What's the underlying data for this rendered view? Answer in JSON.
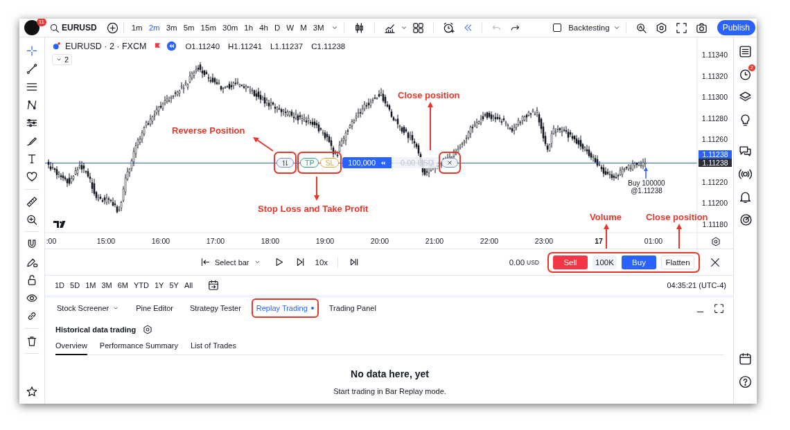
{
  "top_bar": {
    "avatar_badge": "11",
    "symbol": "EURUSD",
    "intervals": [
      {
        "label": "1m",
        "selected": false
      },
      {
        "label": "2m",
        "selected": true
      },
      {
        "label": "3m",
        "selected": false
      },
      {
        "label": "5m",
        "selected": false
      },
      {
        "label": "15m",
        "selected": false
      },
      {
        "label": "30m",
        "selected": false
      },
      {
        "label": "1h",
        "selected": false
      },
      {
        "label": "4h",
        "selected": false
      },
      {
        "label": "D",
        "selected": false
      },
      {
        "label": "W",
        "selected": false
      },
      {
        "label": "M",
        "selected": false
      },
      {
        "label": "3M",
        "selected": false
      }
    ],
    "history_buttons": [
      {
        "disabled": true
      },
      {
        "disabled": false
      }
    ],
    "backtesting": {
      "label": "Backtesting",
      "checked": false
    },
    "publish": "Publish"
  },
  "left_toolbar": {
    "tools": [
      {
        "selected": true
      },
      {
        "selected": false
      },
      {
        "selected": false
      },
      {
        "selected": false
      },
      {
        "selected": false
      },
      {
        "selected": false
      },
      {
        "selected": false
      },
      {
        "selected": false
      },
      {
        "selected": false
      },
      {
        "selected": false
      },
      {
        "selected": false
      },
      {
        "selected": false
      },
      {
        "selected": false
      },
      {
        "selected": false
      },
      {
        "selected": false
      },
      {
        "selected": false
      },
      {
        "selected": false
      }
    ]
  },
  "right_toolbar": {
    "alerts_badge": "2"
  },
  "chart": {
    "title": "EURUSD · 2 · FXCM",
    "ohlc": [
      "O1.11240",
      "H1.11241",
      "L1.11237",
      "C1.11238"
    ],
    "collapsed_count": "2",
    "price_axis": [
      "1.11340",
      "1.11320",
      "1.11300",
      "1.11280",
      "1.11260",
      "1.11220",
      "1.11200",
      "1.11180"
    ],
    "price_tags": [
      {
        "color": "#2962ff",
        "text": "1.11238"
      },
      {
        "color": "#2a2e39",
        "text": "1.11238"
      }
    ],
    "time_axis": [
      {
        "label": ":00",
        "bold": false
      },
      {
        "label": "15:00",
        "bold": false
      },
      {
        "label": "16:00",
        "bold": false
      },
      {
        "label": "17:00",
        "bold": false
      },
      {
        "label": "18:00",
        "bold": false
      },
      {
        "label": "19:00",
        "bold": false
      },
      {
        "label": "20:00",
        "bold": false
      },
      {
        "label": "21:00",
        "bold": false
      },
      {
        "label": "22:00",
        "bold": false
      },
      {
        "label": "23:00",
        "bold": false
      },
      {
        "label": "17",
        "bold": true
      },
      {
        "label": "01:00",
        "bold": false
      }
    ],
    "position": {
      "groups": [
        {
          "kind": "reverse",
          "highlighted": true
        },
        {
          "kind": "brackets",
          "highlighted": true,
          "items": [
            {
              "label": "TP",
              "color": "#26a17b"
            },
            {
              "label": "SL",
              "color": "#e5a43a"
            }
          ]
        },
        {
          "kind": "quantity",
          "highlighted": false,
          "text": "100,000"
        },
        {
          "kind": "pnl",
          "highlighted": false,
          "text": "0.00 USD"
        },
        {
          "kind": "close",
          "highlighted": true
        }
      ]
    },
    "trade_marker": [
      "Buy 100000",
      "@1.11238"
    ]
  },
  "annotations": [
    "Reverse Position",
    "Stop Loss and Take Profit",
    "Close position",
    "Volume",
    "Close position"
  ],
  "replay_bar": {
    "select_bar": "Select bar",
    "speed": "10x",
    "pnl": {
      "value": "0.00",
      "currency": "USD"
    },
    "order_panel": {
      "highlighted": true,
      "buttons": [
        {
          "kind": "sell",
          "label": "Sell"
        },
        {
          "kind": "quantity",
          "label": "100K"
        },
        {
          "kind": "buy",
          "label": "Buy"
        },
        {
          "kind": "flatten",
          "label": "Flatten"
        }
      ]
    }
  },
  "range_bar": {
    "ranges": [
      "1D",
      "5D",
      "1M",
      "3M",
      "6M",
      "YTD",
      "1Y",
      "5Y",
      "All"
    ],
    "clock": "04:35:21 (UTC-4)"
  },
  "bottom_panel": {
    "tabs": [
      {
        "label": "Stock Screener",
        "selected": false,
        "dropdown": true,
        "dot": false,
        "highlighted": false
      },
      {
        "label": "Pine Editor",
        "selected": false,
        "dropdown": false,
        "dot": false,
        "highlighted": false
      },
      {
        "label": "Strategy Tester",
        "selected": false,
        "dropdown": false,
        "dot": false,
        "highlighted": false
      },
      {
        "label": "Replay Trading",
        "selected": true,
        "dropdown": false,
        "dot": true,
        "highlighted": true
      },
      {
        "label": "Trading Panel",
        "selected": false,
        "dropdown": false,
        "dot": false,
        "highlighted": false
      }
    ],
    "title": "Historical data trading",
    "subtabs": [
      {
        "label": "Overview",
        "selected": true
      },
      {
        "label": "Performance Summary",
        "selected": false
      },
      {
        "label": "List of Trades",
        "selected": false
      }
    ],
    "empty_title": "No data here, yet",
    "empty_text": "Start trading in Bar Replay mode."
  }
}
